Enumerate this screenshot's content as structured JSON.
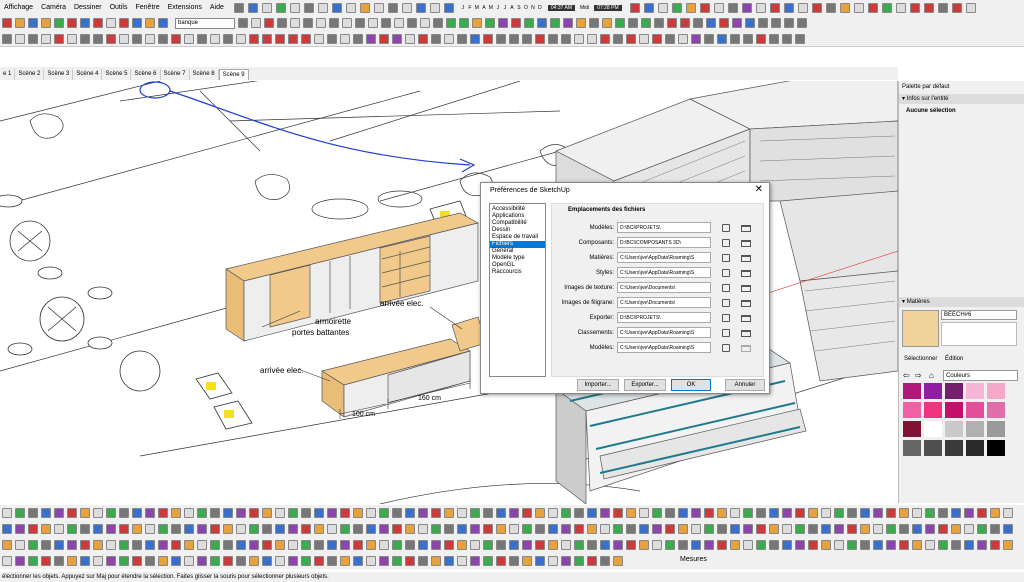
{
  "menu": {
    "items": [
      "Affichage",
      "Caméra",
      "Dessiner",
      "Outils",
      "Fenêtre",
      "Extensions",
      "Aide"
    ]
  },
  "shadow": {
    "months": [
      "J",
      "F",
      "M",
      "A",
      "M",
      "J",
      "J",
      "A",
      "S",
      "O",
      "N",
      "D"
    ],
    "time_start": "04:37 AM",
    "noon": "Midi",
    "time_end": "07:28 PM"
  },
  "layer": {
    "value": "banque"
  },
  "scenes": {
    "tabs": [
      "e 1",
      "Scène 2",
      "Scène 3",
      "Scène 4",
      "Scène 5",
      "Scène 6",
      "Scène 7",
      "Scène 8",
      "Scène 9"
    ],
    "active_index": 8
  },
  "viewport": {
    "label_armoirette": "armoirette",
    "label_portes": "portes battantes",
    "label_arrivee1": "arrivée elec.",
    "label_arrivee2": "arrivée elec.",
    "dim_100": "100 cm",
    "dim_160": "160 cm"
  },
  "dialog": {
    "title": "Préférences de SketchUp",
    "close": "✕",
    "nav": [
      "Accessibilité",
      "Applications",
      "Compatibilité",
      "Dessin",
      "Espace de travail",
      "Fichiers",
      "Général",
      "Modèle type",
      "OpenGL",
      "Raccourcis"
    ],
    "nav_selected": "Fichiers",
    "heading": "Emplacements des fichiers",
    "rows": [
      {
        "label": "Modèles:",
        "path": "D:\\BCI\\PROJETS\\"
      },
      {
        "label": "Composants:",
        "path": "D:\\BCI\\COMPOSANTS 3D\\"
      },
      {
        "label": "Matières:",
        "path": "C:\\Users\\jve\\AppData\\Roaming\\S"
      },
      {
        "label": "Styles:",
        "path": "C:\\Users\\jve\\AppData\\Roaming\\S"
      },
      {
        "label": "Images de texture:",
        "path": "C:\\Users\\jve\\Documents\\"
      },
      {
        "label": "Images de filigrane:",
        "path": "C:\\Users\\jve\\Documents\\"
      },
      {
        "label": "Exporter:",
        "path": "D:\\BCI\\PROJETS\\"
      },
      {
        "label": "Classements:",
        "path": "C:\\Users\\jve\\AppData\\Roaming\\S"
      },
      {
        "label": "Modèles:",
        "path": "C:\\Users\\jve\\AppData\\Roaming\\S"
      }
    ],
    "buttons": {
      "import": "Importer...",
      "export": "Exporter...",
      "ok": "OK",
      "cancel": "Annuler"
    }
  },
  "right_panel": {
    "title": "Palette par défaut",
    "entity_header": "Infos sur l'entité",
    "entity_value": "Aucune sélection",
    "materials_header": "Matières",
    "material_name": "BEECH#6",
    "tab_select": "Sélectionner",
    "tab_edit": "Édition",
    "color_set": "Couleurs",
    "swatches": [
      "#b0197a",
      "#8e1fa5",
      "#74206c",
      "#f5b5d4",
      "#f5a8c8",
      "#f25fa5",
      "#f0337f",
      "#c40f6d",
      "#e64d9a",
      "#de6fa8",
      "#801333",
      "#ffffff",
      "#c9c9c9",
      "#b0b0b0",
      "#9a9a9a",
      "#666666",
      "#505050",
      "#3a3a3a",
      "#2a2a2a",
      "#000000"
    ],
    "swatch_count_extra": 1
  },
  "bottom": {
    "measure_label": "Mesures",
    "status": "électionner les objets. Appuyez sur Maj pour étendre la sélection. Faites glisser la souris pour sélectionner plusieurs objets."
  },
  "colors": {
    "annotation_blue": "#1f3bd6",
    "wood": "#f1c98a",
    "selection_blue": "#0078d7"
  }
}
